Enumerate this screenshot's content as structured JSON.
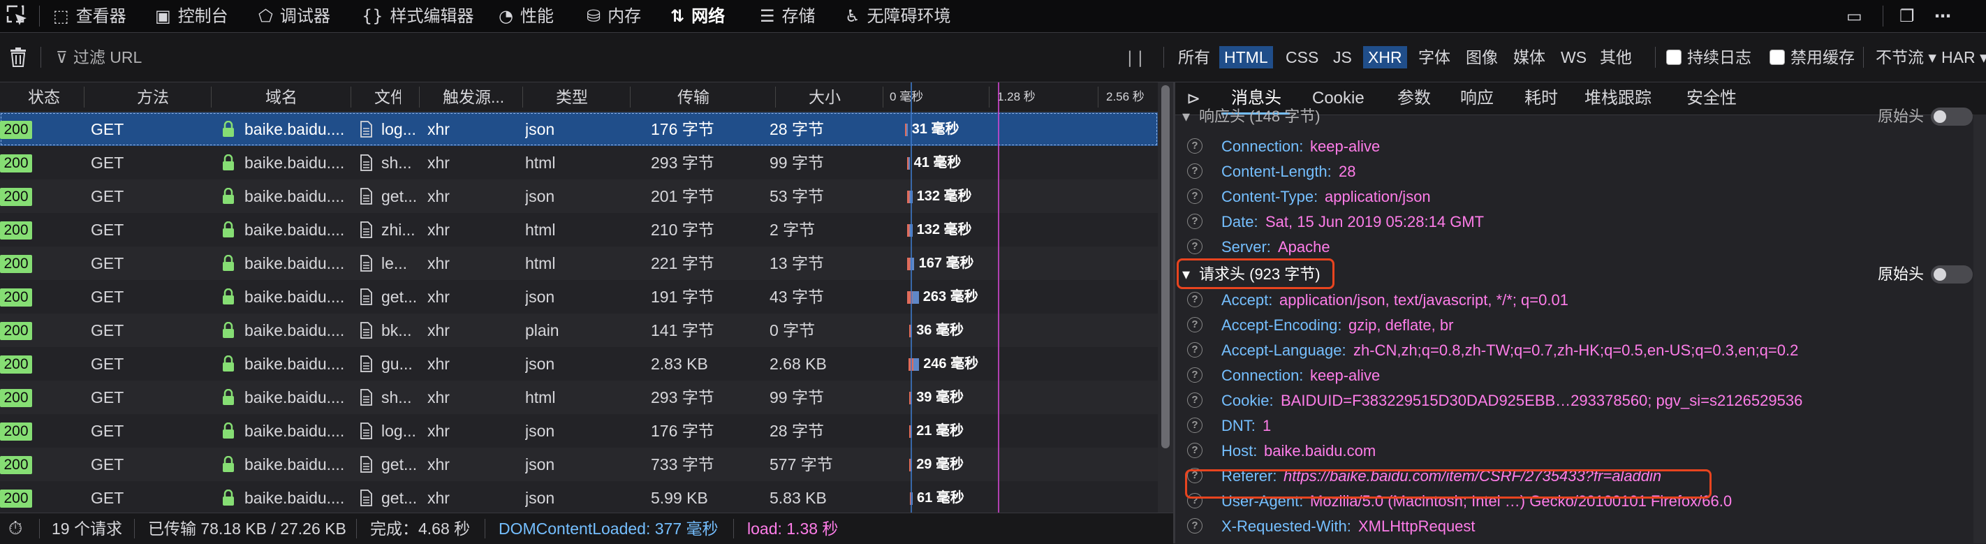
{
  "toolbar": {
    "tools": [
      {
        "label": "查看器",
        "icon": "inspector-icon"
      },
      {
        "label": "控制台",
        "icon": "console-icon"
      },
      {
        "label": "调试器",
        "icon": "debugger-icon"
      },
      {
        "label": "样式编辑器",
        "icon": "style-editor-icon"
      },
      {
        "label": "性能",
        "icon": "performance-icon"
      },
      {
        "label": "内存",
        "icon": "memory-icon"
      },
      {
        "label": "网络",
        "icon": "network-icon"
      },
      {
        "label": "存储",
        "icon": "storage-icon"
      },
      {
        "label": "无障碍环境",
        "icon": "accessibility-icon"
      }
    ],
    "active_tool": "网络"
  },
  "filterbar": {
    "filter_placeholder": "过滤 URL",
    "types": [
      "所有",
      "HTML",
      "CSS",
      "JS",
      "XHR",
      "字体",
      "图像",
      "媒体",
      "WS",
      "其他"
    ],
    "active_types": [
      "HTML",
      "XHR"
    ],
    "persist_logs": "持续日志",
    "disable_cache": "禁用缓存",
    "throttle": "不节流 ▾",
    "har": "HAR ▾"
  },
  "table": {
    "columns": [
      "状态",
      "方法",
      "域名",
      "文件",
      "触发源...",
      "类型",
      "传输",
      "大小"
    ],
    "timeline_ticks": [
      "0 毫秒",
      "1.28 秒",
      "2.56 秒"
    ],
    "rows": [
      {
        "status": "200",
        "method": "GET",
        "domain": "baike.baidu....",
        "file": "log...",
        "cause": "xhr",
        "type": "json",
        "transferred": "176 字节",
        "size": "28 字节",
        "time": "31 毫秒",
        "offset": 0.01,
        "width": 0.004,
        "selected": true
      },
      {
        "status": "200",
        "method": "GET",
        "domain": "baike.baidu....",
        "file": "sh...",
        "cause": "xhr",
        "type": "html",
        "transferred": "293 字节",
        "size": "99 字节",
        "time": "41 毫秒",
        "offset": 0.018,
        "width": 0.006
      },
      {
        "status": "200",
        "method": "GET",
        "domain": "baike.baidu....",
        "file": "get...",
        "cause": "xhr",
        "type": "json",
        "transferred": "201 字节",
        "size": "53 字节",
        "time": "132 毫秒",
        "offset": 0.018,
        "width": 0.022
      },
      {
        "status": "200",
        "method": "GET",
        "domain": "baike.baidu....",
        "file": "zhi...",
        "cause": "xhr",
        "type": "html",
        "transferred": "210 字节",
        "size": "2 字节",
        "time": "132 毫秒",
        "offset": 0.018,
        "width": 0.022
      },
      {
        "status": "200",
        "method": "GET",
        "domain": "baike.baidu....",
        "file": "le...",
        "cause": "xhr",
        "type": "html",
        "transferred": "221 字节",
        "size": "13 字节",
        "time": "167 毫秒",
        "offset": 0.02,
        "width": 0.028
      },
      {
        "status": "200",
        "method": "GET",
        "domain": "baike.baidu....",
        "file": "get...",
        "cause": "xhr",
        "type": "json",
        "transferred": "191 字节",
        "size": "43 字节",
        "time": "263 毫秒",
        "offset": 0.02,
        "width": 0.045
      },
      {
        "status": "200",
        "method": "GET",
        "domain": "baike.baidu....",
        "file": "bk...",
        "cause": "xhr",
        "type": "plain",
        "transferred": "141 字节",
        "size": "0 字节",
        "time": "36 毫秒",
        "offset": 0.028,
        "width": 0.005
      },
      {
        "status": "200",
        "method": "GET",
        "domain": "baike.baidu....",
        "file": "gu...",
        "cause": "xhr",
        "type": "json",
        "transferred": "2.83 KB",
        "size": "2.68 KB",
        "time": "246 毫秒",
        "offset": 0.024,
        "width": 0.042
      },
      {
        "status": "200",
        "method": "GET",
        "domain": "baike.baidu....",
        "file": "sh...",
        "cause": "xhr",
        "type": "html",
        "transferred": "293 字节",
        "size": "99 字节",
        "time": "39 毫秒",
        "offset": 0.028,
        "width": 0.006
      },
      {
        "status": "200",
        "method": "GET",
        "domain": "baike.baidu....",
        "file": "log...",
        "cause": "xhr",
        "type": "json",
        "transferred": "176 字节",
        "size": "28 字节",
        "time": "21 毫秒",
        "offset": 0.028,
        "width": 0.004
      },
      {
        "status": "200",
        "method": "GET",
        "domain": "baike.baidu....",
        "file": "get...",
        "cause": "xhr",
        "type": "json",
        "transferred": "733 字节",
        "size": "577 字节",
        "time": "29 毫秒",
        "offset": 0.028,
        "width": 0.005
      },
      {
        "status": "200",
        "method": "GET",
        "domain": "baike.baidu....",
        "file": "get...",
        "cause": "xhr",
        "type": "json",
        "transferred": "5.99 KB",
        "size": "5.83 KB",
        "time": "61 毫秒",
        "offset": 0.03,
        "width": 0.01
      }
    ]
  },
  "statusbar": {
    "requests": "19 个请求",
    "transferred": "已传输 78.18 KB / 27.26 KB",
    "finish": "完成：4.68 秒",
    "dom": "DOMContentLoaded: 377 毫秒",
    "load": "load: 1.38 秒"
  },
  "details": {
    "tabs": [
      "消息头",
      "Cookie",
      "参数",
      "响应",
      "耗时",
      "堆栈跟踪",
      "安全性"
    ],
    "active_tab": "消息头",
    "response_section_title": "响应头 (148 字节)",
    "raw_label": "原始头",
    "response_headers": [
      {
        "key": "Connection:",
        "value": "keep-alive"
      },
      {
        "key": "Content-Length:",
        "value": "28"
      },
      {
        "key": "Content-Type:",
        "value": "application/json"
      },
      {
        "key": "Date:",
        "value": "Sat, 15 Jun 2019 05:28:14 GMT"
      },
      {
        "key": "Server:",
        "value": "Apache"
      }
    ],
    "request_section_title": "请求头 (923 字节)",
    "request_headers": [
      {
        "key": "Accept:",
        "value": "application/json, text/javascript, */*; q=0.01"
      },
      {
        "key": "Accept-Encoding:",
        "value": "gzip, deflate, br"
      },
      {
        "key": "Accept-Language:",
        "value": "zh-CN,zh;q=0.8,zh-TW;q=0.7,zh-HK;q=0.5,en-US;q=0.3,en;q=0.2"
      },
      {
        "key": "Connection:",
        "value": "keep-alive"
      },
      {
        "key": "Cookie:",
        "value": "BAIDUID=F383229515D30DAD925EBB…293378560; pgv_si=s2126529536"
      },
      {
        "key": "DNT:",
        "value": "1"
      },
      {
        "key": "Host:",
        "value": "baike.baidu.com"
      },
      {
        "key": "Referer:",
        "value": "https://baike.baidu.com/item/CSRF/2735433?fr=aladdin"
      },
      {
        "key": "User-Agent:",
        "value": "Mozilla/5.0 (Macintosh; Intel …) Gecko/20100101 Firefox/66.0"
      },
      {
        "key": "X-Requested-With:",
        "value": "XMLHttpRequest"
      }
    ]
  },
  "colors": {
    "accent": "#204e8a",
    "status_ok": "#86de74",
    "header_key": "#75bfff",
    "header_value": "#ff7de9",
    "highlight": "#e8441f"
  }
}
